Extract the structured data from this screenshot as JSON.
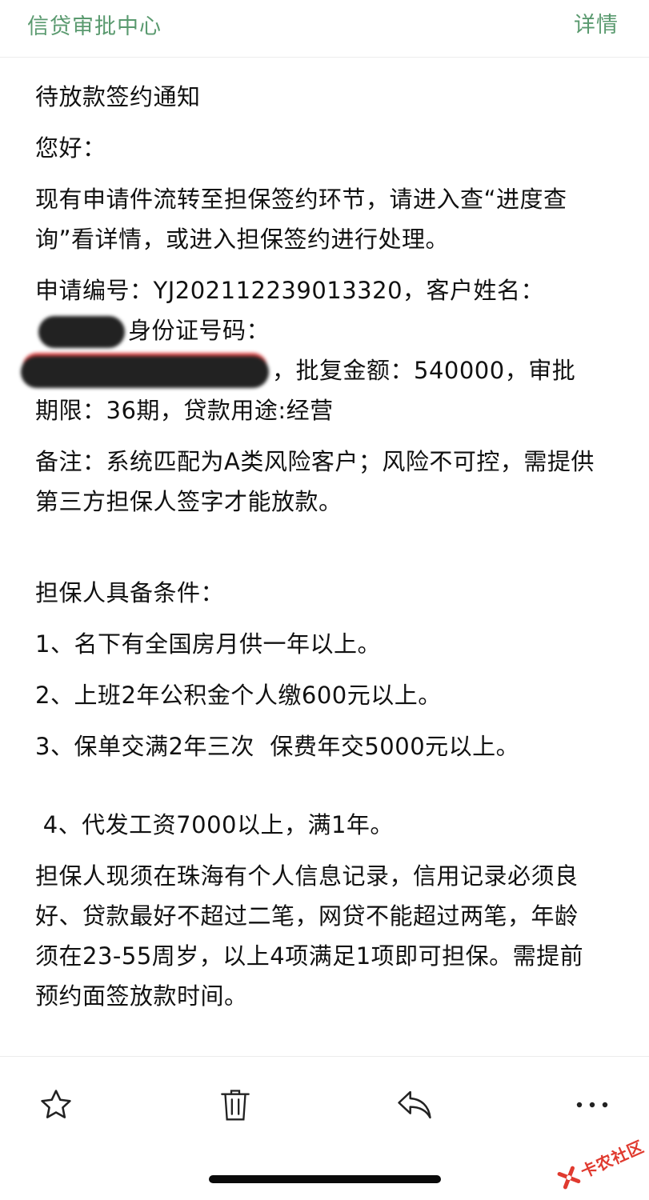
{
  "header": {
    "title": "信贷审批中心",
    "detail_label": "详情"
  },
  "message": {
    "subject": "待放款签约通知",
    "greeting": "您好：",
    "intro": "现有申请件流转至担保签约环节，请进入查“进度查询”看详情，或进入担保签约进行处理。",
    "application": {
      "label_prefix": "申请编号：YJ202112239013320，客户姓名：",
      "id_label": "身份证号码：",
      "after_id": "，批复金额：540000，审批期限：36期，贷款用途:经营"
    },
    "remark": "备注：系统匹配为A类风险客户；风险不可控，需提供第三方担保人签字才能放款。",
    "conditions_title": "担保人具备条件：",
    "conditions": [
      "1、名下有全国房月供一年以上。",
      "2、上班2年公积金个人缴600元以上。",
      "3、保单交满2年三次  保费年交5000元以上。"
    ],
    "condition_4": " 4、代发工资7000以上，满1年。",
    "closing": "担保人现须在珠海有个人信息记录，信用记录必须良好、贷款最好不超过二笔，网贷不能超过两笔，年龄须在23-55周岁，以上4项满足1项即可担保。需提前预约面签放款时间。"
  },
  "toolbar": {
    "icons": [
      "star-icon",
      "trash-icon",
      "reply-icon",
      "more-icon"
    ]
  },
  "watermark": {
    "text": "卡农社区"
  },
  "colors": {
    "header_accent": "#5a9a6f",
    "watermark": "#e03a2f"
  }
}
